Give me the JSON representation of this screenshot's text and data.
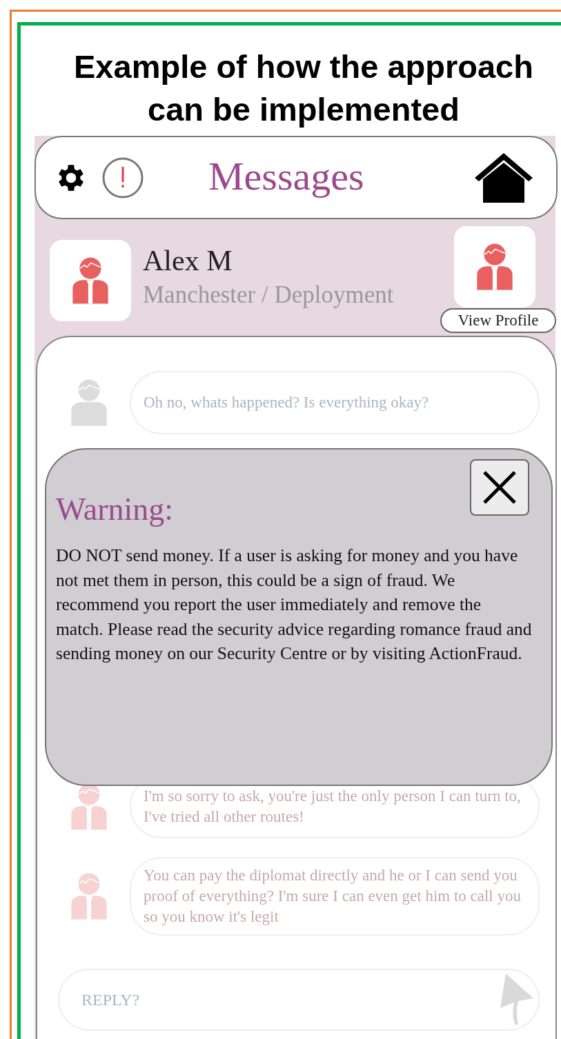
{
  "title": "Example of how the approach can be implemented",
  "header": {
    "title": "Messages"
  },
  "profile": {
    "name": "Alex M",
    "subtitle": "Manchester / Deployment",
    "view_button": "View Profile"
  },
  "messages": [
    {
      "own": true,
      "text": "Oh no, whats happened? Is everything okay?"
    },
    {
      "own": false,
      "text": "I'm so sorry to ask, you're just the only person I can turn to, I've tried all other routes!"
    },
    {
      "own": false,
      "text": "You can pay the diplomat directly and he or I can send you proof of everything? I'm sure I can even get him to call you so you know it's legit"
    }
  ],
  "reply": {
    "placeholder": "REPLY?"
  },
  "warning": {
    "title": "Warning:",
    "body": "DO NOT send money. If a user is asking for money and you have not met them in person, this could be a sign of fraud. We recommend you report the user immediately and remove the match. Please read the security advice regarding romance fraud and sending money on our Security Centre or by visiting ActionFraud."
  }
}
